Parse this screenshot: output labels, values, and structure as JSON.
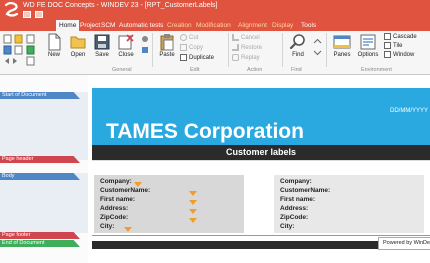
{
  "window": {
    "title": "WD FE DOC Concepts - WINDEV 23 - [RPT_CustomerLabels]"
  },
  "tabs": [
    {
      "label": "Home",
      "active": true
    },
    {
      "label": "Project"
    },
    {
      "label": "SCM"
    },
    {
      "label": "Automatic tests"
    },
    {
      "label": "Creation",
      "contextual": true
    },
    {
      "label": "Modification",
      "contextual": true
    },
    {
      "label": "Alignment",
      "contextual": true
    },
    {
      "label": "Display",
      "contextual": true
    },
    {
      "label": "Tools"
    }
  ],
  "ribbon": {
    "general": {
      "label": "General",
      "new": "New",
      "open": "Open",
      "save": "Save",
      "close": "Close"
    },
    "edit": {
      "label": "Edit",
      "paste": "Paste",
      "cut": "Cut",
      "copy": "Copy",
      "duplicate": "Duplicate"
    },
    "action": {
      "label": "Action",
      "cancel": "Cancel",
      "restore": "Restore",
      "replay": "Replay"
    },
    "find": {
      "label": "Find",
      "find": "Find"
    },
    "environment": {
      "label": "Environment",
      "panes": "Panes",
      "options": "Options",
      "cascade": "Cascade",
      "tile": "Tile",
      "window": "Window"
    }
  },
  "bands": {
    "start": "Start of Document",
    "page_header": "Page header",
    "body": "Body",
    "page_footer": "Page footer",
    "end": "End of Document"
  },
  "report": {
    "date_placeholder": "DD/MM/YYYY",
    "company": "TAMES Corporation",
    "labels_title": "Customer labels",
    "fields": [
      "Company:",
      "CustomerName:",
      "First name:",
      "Address:",
      "ZipCode:",
      "City:"
    ],
    "powered_by": "Powered by WinDev"
  },
  "colors": {
    "titlebar": "#e0533f",
    "header_band": "#2aa8e0",
    "dark_bar": "#2b2b2b"
  }
}
